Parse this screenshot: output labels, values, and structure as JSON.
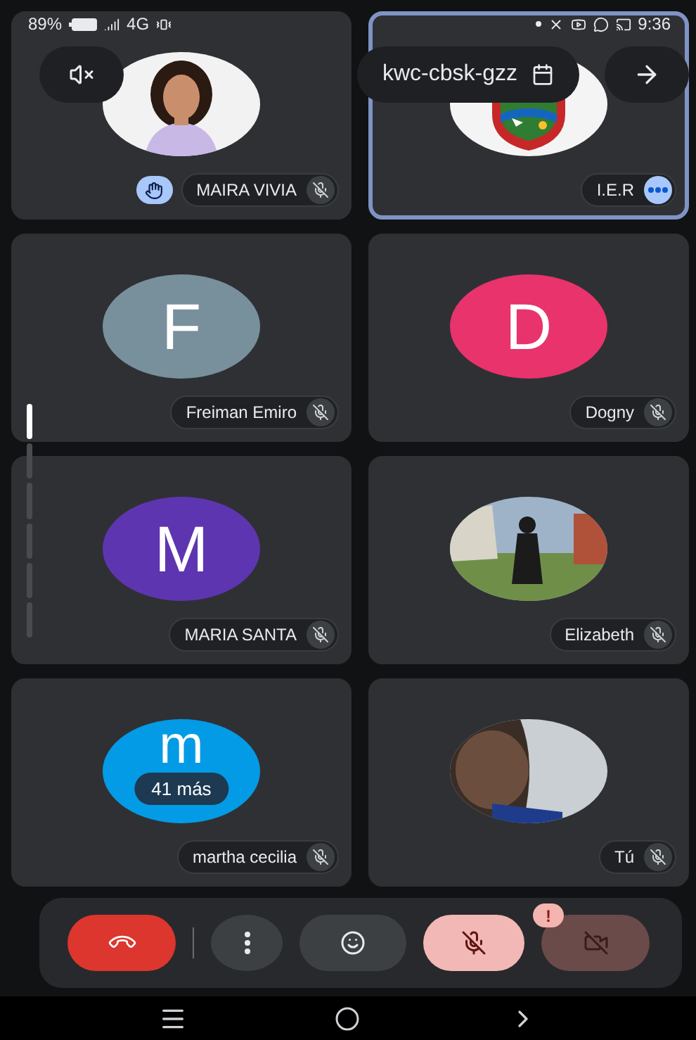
{
  "status_bar": {
    "battery": "89%",
    "network": "4G",
    "time": "9:36"
  },
  "meeting_code": "kwc-cbsk-gzz",
  "tiles": [
    {
      "name": "MAIRA VIVIA",
      "kind": "picture",
      "highlighted": false,
      "muted": true,
      "hand_raised": true
    },
    {
      "name": "I.E.R",
      "kind": "picture",
      "highlighted": true,
      "muted": false,
      "hand_raised": false
    },
    {
      "name": "Freiman Emiro",
      "kind": "avatar",
      "initial": "F",
      "color": "#78909c",
      "highlighted": false,
      "muted": true,
      "hand_raised": false
    },
    {
      "name": "Dogny",
      "kind": "avatar",
      "initial": "D",
      "color": "#e8336d",
      "highlighted": false,
      "muted": true,
      "hand_raised": false
    },
    {
      "name": "MARIA SANTA",
      "kind": "avatar",
      "initial": "M",
      "color": "#5e35b1",
      "highlighted": false,
      "muted": true,
      "hand_raised": false
    },
    {
      "name": "Elizabeth",
      "kind": "picture",
      "highlighted": false,
      "muted": true,
      "hand_raised": false
    },
    {
      "name": "martha cecilia",
      "kind": "avatar",
      "initial": "m",
      "color": "#039be5",
      "highlighted": false,
      "muted": true,
      "hand_raised": false,
      "overflow": "41 más"
    },
    {
      "name": "Tú",
      "kind": "picture",
      "highlighted": false,
      "muted": true,
      "hand_raised": false
    }
  ],
  "controls": [
    {
      "kind": "end_call"
    },
    {
      "kind": "more"
    },
    {
      "kind": "reactions"
    },
    {
      "kind": "microphone",
      "on": false
    },
    {
      "kind": "camera",
      "on": false,
      "alert": "!"
    }
  ]
}
